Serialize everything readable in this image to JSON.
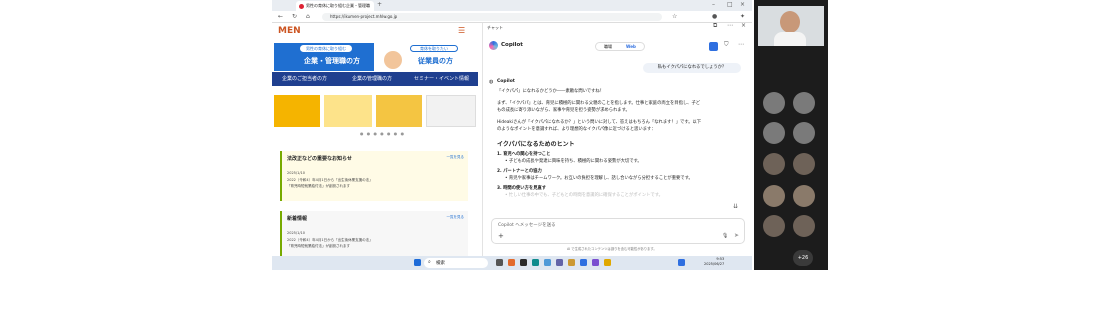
{
  "browser": {
    "tab_title": "男性の育休に取り組む企業・管理職",
    "url": "https://ikumen-project.mhlw.go.jp"
  },
  "site": {
    "logo": "MEN",
    "card_left_pill": "男性の育休に取り組む",
    "card_left_title": "企業・管理職の方",
    "card_right_pill": "育休を取りたい",
    "card_right_title": "従業員の方",
    "nav": [
      "企業のご担当者の方",
      "企業の管理職の方",
      "セミナー・イベント情報"
    ],
    "dots": "● ● ● ● ● ● ●",
    "news1": {
      "heading": "法改正などの重要なお知らせ",
      "more": "一覧を見る",
      "date": "2025/1/10",
      "line1": "2022（令和4）年4月1日から「出生後休業支援の法」",
      "line2": "「育児時短就業給付法」が創設されます"
    },
    "news2": {
      "heading": "新着情報",
      "more": "一覧を見る",
      "date": "2025/1/10",
      "line1": "2022（令和4）年4月1日から「出生後休業支援の法」",
      "line2": "「育児時短就業給付法」が創設されます"
    }
  },
  "copilot": {
    "pane_title": "チャット",
    "app_name": "Copilot",
    "toggle_work": "職場",
    "toggle_web": "Web",
    "user_message": "私もイクパパになれるでしょうか？",
    "author": "Copilot",
    "p1": "「イクパパ」になれるかどうか――素敵な問いですね！",
    "p2a": "まず、「イクパパ」とは、育児に積極的に関わる父親のことを指します。仕事と家庭の両立を目指し、子ど",
    "p2b": "もの成長に寄り添いながら、家事や育児を担う姿勢が求められます。",
    "p3a": "Hideakiさんが「イクパパになれるか？」という問いに対して、答えはもちろん「なれます！」です。以下",
    "p3b": "のようなポイントを意識すれば、より理想的なイクパパ像に近づけると思います：",
    "heading": "イクパパになるためのヒント",
    "tips": [
      {
        "title": "1. 育児への関心を持つこと",
        "bullet": "• 子どもの成長や発達に興味を持ち、積極的に関わる姿勢が大切です。"
      },
      {
        "title": "2. パートナーとの協力",
        "bullet": "• 育児や家事はチームワーク。お互いの負担を理解し、話し合いながら分担することが重要です。"
      },
      {
        "title": "3. 時間の使い方を見直す",
        "bullet": "• 忙しい仕事の中でも、子どもとの時間を意識的に確保することがポイントです。"
      }
    ],
    "input_placeholder": "Copilot へメッセージを送る",
    "disclaimer": "AI で生成されたコンテンツは誤りを含む可能性があります。"
  },
  "taskbar": {
    "search": "検索",
    "time": "9:53",
    "date": "2025/06/27"
  },
  "meeting": {
    "more_count": "+26"
  },
  "colors": {
    "brand_blue": "#1f6fd1",
    "nav_navy": "#1f3f8f",
    "copilot_blue": "#2f6fe0"
  }
}
